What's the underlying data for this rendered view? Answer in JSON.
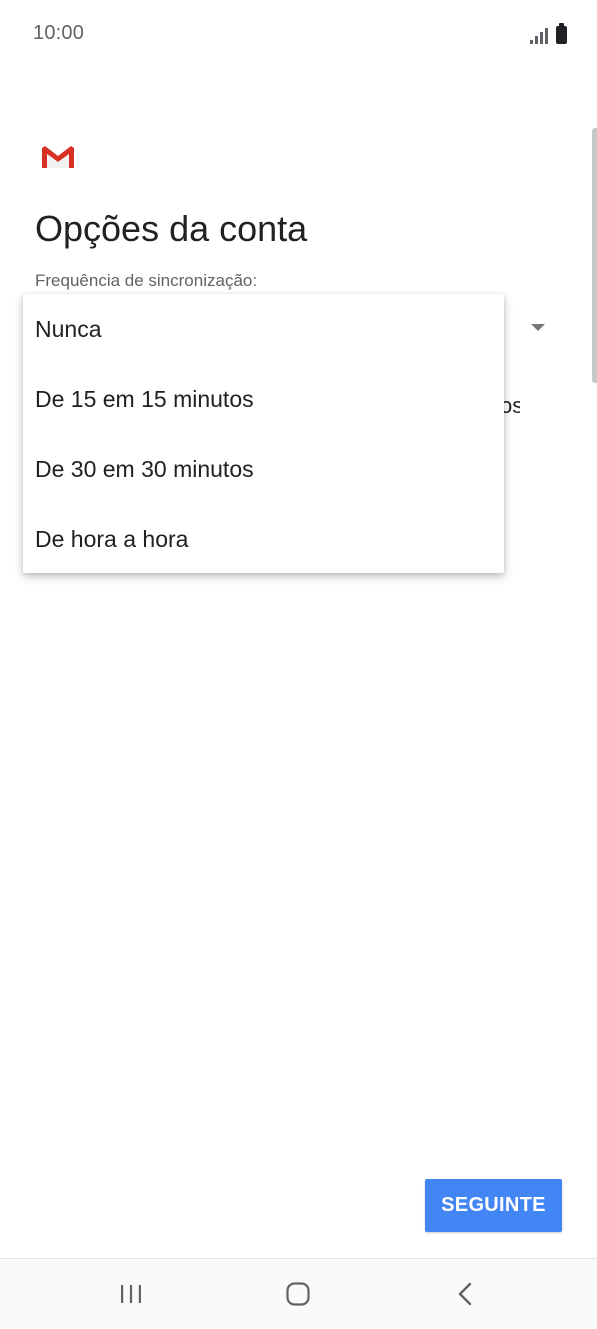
{
  "status_bar": {
    "time": "10:00",
    "icons": [
      "signal-icon",
      "battery-icon"
    ]
  },
  "header": {
    "logo": "gmail-logo",
    "title": "Opções da conta"
  },
  "sync": {
    "label": "Frequência de sincronização:",
    "hidden_text_peek": "os"
  },
  "dropdown_menu": {
    "items": [
      {
        "label": "Nunca"
      },
      {
        "label": "De 15 em 15 minutos"
      },
      {
        "label": "De 30 em 30 minutos"
      },
      {
        "label": "De hora a hora"
      }
    ]
  },
  "footer": {
    "next_label": "SEGUINTE"
  },
  "nav_bar": {
    "buttons": [
      "recents-icon",
      "home-icon",
      "back-icon"
    ]
  },
  "colors": {
    "accent": "#4285f4",
    "gmail_red": "#d93025"
  }
}
